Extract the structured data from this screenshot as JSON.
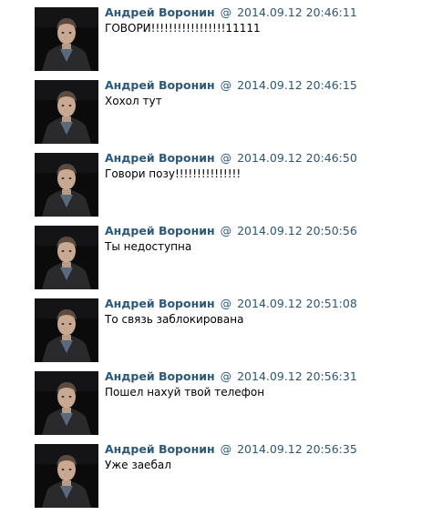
{
  "messages": [
    {
      "author": "Андрей Воронин",
      "at": "@",
      "date": "2014.09.12 20:46:11",
      "text": "ГОВОРИ!!!!!!!!!!!!!!!!!11111"
    },
    {
      "author": "Андрей Воронин",
      "at": "@",
      "date": "2014.09.12 20:46:15",
      "text": "Хохол тут"
    },
    {
      "author": "Андрей Воронин",
      "at": "@",
      "date": "2014.09.12 20:46:50",
      "text": "Говори позу!!!!!!!!!!!!!!!"
    },
    {
      "author": "Андрей Воронин",
      "at": "@",
      "date": "2014.09.12 20:50:56",
      "text": "Ты недоступна"
    },
    {
      "author": "Андрей Воронин",
      "at": "@",
      "date": "2014.09.12 20:51:08",
      "text": "То связь заблокирована"
    },
    {
      "author": "Андрей Воронин",
      "at": "@",
      "date": "2014.09.12 20:56:31",
      "text": "Пошел нахуй твой телефон"
    },
    {
      "author": "Андрей Воронин",
      "at": "@",
      "date": "2014.09.12 20:56:35",
      "text": "Уже заебал"
    }
  ],
  "avatar_icon": "user-photo-icon",
  "colors": {
    "author": "#2b587a",
    "text": "#000000",
    "background": "#ffffff",
    "avatar_bg": "#0b0b0c"
  }
}
